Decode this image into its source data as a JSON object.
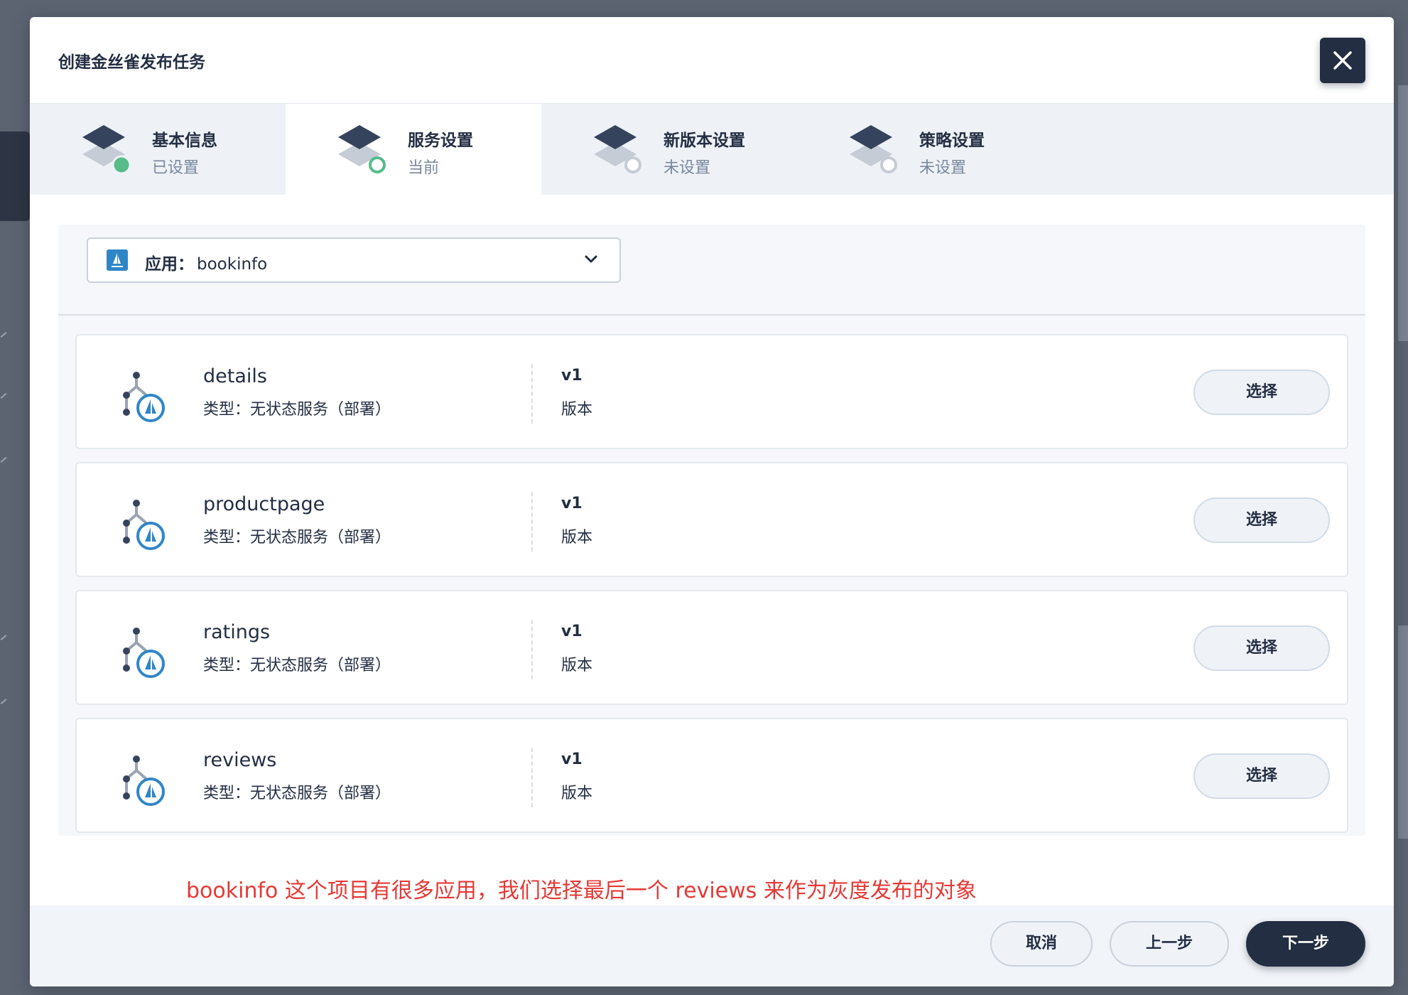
{
  "modal": {
    "title": "创建金丝雀发布任务"
  },
  "steps": [
    {
      "title": "基本信息",
      "status": "已设置",
      "state": "done"
    },
    {
      "title": "服务设置",
      "status": "当前",
      "state": "current"
    },
    {
      "title": "新版本设置",
      "status": "未设置",
      "state": "pending"
    },
    {
      "title": "策略设置",
      "status": "未设置",
      "state": "pending"
    }
  ],
  "app_selector": {
    "label": "应用：",
    "value": "bookinfo"
  },
  "services": [
    {
      "name": "details",
      "type": "类型：无状态服务（部署）",
      "version": "v1",
      "version_label": "版本",
      "action": "选择"
    },
    {
      "name": "productpage",
      "type": "类型：无状态服务（部署）",
      "version": "v1",
      "version_label": "版本",
      "action": "选择"
    },
    {
      "name": "ratings",
      "type": "类型：无状态服务（部署）",
      "version": "v1",
      "version_label": "版本",
      "action": "选择"
    },
    {
      "name": "reviews",
      "type": "类型：无状态服务（部署）",
      "version": "v1",
      "version_label": "版本",
      "action": "选择"
    }
  ],
  "annotation": "bookinfo 这个项目有很多应用，我们选择最后一个 reviews 来作为灰度发布的对象",
  "footer": {
    "cancel_label": "取消",
    "prev_label": "上一步",
    "next_label": "下一步"
  },
  "colors": {
    "primary_dark": "#242e42",
    "success": "#55bc8a",
    "annotation_red": "#e53935",
    "istio_blue": "#2f86c7"
  }
}
